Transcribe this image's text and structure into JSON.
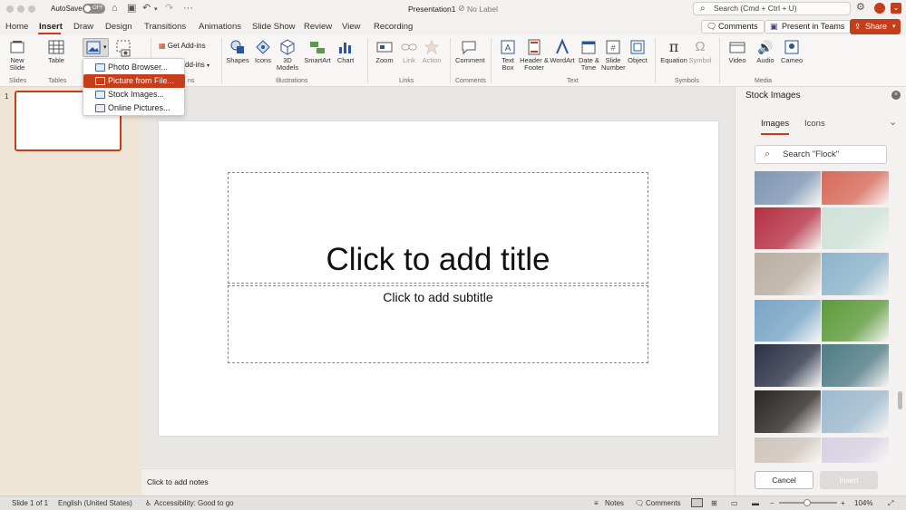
{
  "window": {
    "title": "Presentation1",
    "label_status": "No Label",
    "autosave_label": "AutoSave",
    "autosave_state": "OFF"
  },
  "search": {
    "placeholder": "Search (Cmd + Ctrl + U)"
  },
  "menu_tabs": [
    "Home",
    "Insert",
    "Draw",
    "Design",
    "Transitions",
    "Animations",
    "Slide Show",
    "Review",
    "View",
    "Recording"
  ],
  "header_buttons": {
    "comments": "Comments",
    "present_teams": "Present in Teams",
    "share": "Share"
  },
  "ribbon": {
    "new_slide": "New\nSlide",
    "table": "Table",
    "get_addins": "Get Add-ins",
    "my_addins": "dd-ins",
    "shapes": "Shapes",
    "icons": "Icons",
    "models": "3D\nModels",
    "smartart": "SmartArt",
    "chart": "Chart",
    "zoom": "Zoom",
    "link": "Link",
    "action": "Action",
    "comment": "Comment",
    "text_box": "Text\nBox",
    "header_footer": "Header &\nFooter",
    "wordart": "WordArt",
    "date_time": "Date &\nTime",
    "slide_number": "Slide\nNumber",
    "object": "Object",
    "equation": "Equation",
    "symbol": "Symbol",
    "video": "Video",
    "audio": "Audio",
    "cameo": "Cameo",
    "groups": {
      "slides": "Slides",
      "tables": "Tables",
      "addins_tail": "ns",
      "illustrations": "Illustrations",
      "links": "Links",
      "comments": "Comments",
      "text": "Text",
      "symbols": "Symbols",
      "media": "Media"
    }
  },
  "picture_menu": {
    "items": [
      "Photo Browser...",
      "Picture from File...",
      "Stock Images...",
      "Online Pictures..."
    ],
    "selected_index": 1
  },
  "slide": {
    "number": "1",
    "title_placeholder": "Click to add title",
    "subtitle_placeholder": "Click to add subtitle",
    "notes_placeholder": "Click to add notes"
  },
  "stock_panel": {
    "title": "Stock Images",
    "tab_images": "Images",
    "tab_icons": "Icons",
    "search_value": "Search \"Flock\"",
    "cancel": "Cancel",
    "insert": "Insert",
    "thumbnails": [
      {
        "color": "#7d97b3"
      },
      {
        "color": "#d86b5a"
      },
      {
        "color": "#b62f43"
      },
      {
        "color": "#cfe2d9"
      },
      {
        "color": "#b9aea1"
      },
      {
        "color": "#8db4cc"
      },
      {
        "color": "#78a6c7"
      },
      {
        "color": "#5e9b3c"
      },
      {
        "color": "#2b3247"
      },
      {
        "color": "#4f7c86"
      },
      {
        "color": "#2a2724"
      },
      {
        "color": "#9dbad0"
      },
      {
        "color": "#cfc6bb"
      },
      {
        "color": "#d7d2e3"
      }
    ]
  },
  "status": {
    "slide_of": "Slide 1 of 1",
    "language": "English (United States)",
    "accessibility": "Accessibility: Good to go",
    "notes": "Notes",
    "comments": "Comments",
    "zoom": "104%"
  },
  "colors": {
    "accent": "#c43e1c"
  }
}
